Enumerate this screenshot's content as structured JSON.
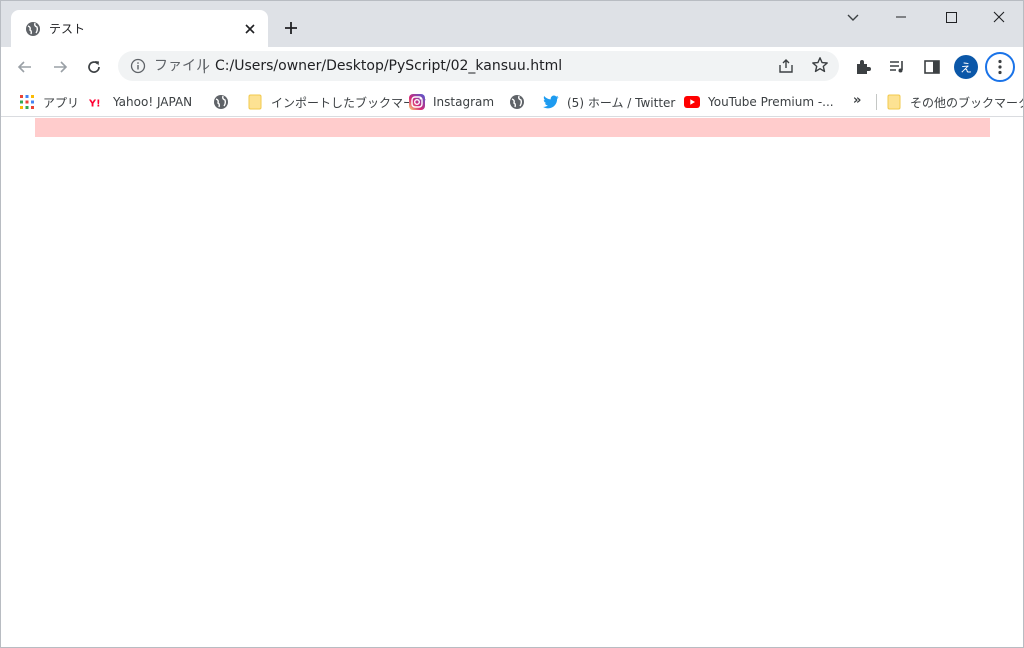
{
  "tab": {
    "title": "テスト"
  },
  "omnibox": {
    "scheme_label": "ファイル",
    "separator": "|",
    "url": "C:/Users/owner/Desktop/PyScript/02_kansuu.html"
  },
  "profile": {
    "initial": "え"
  },
  "bookmarks": [
    {
      "label": "アプリ",
      "icon": "apps-grid-icon"
    },
    {
      "label": "Yahoo! JAPAN",
      "icon": "yahoo-icon"
    },
    {
      "label": "",
      "icon": "globe-icon"
    },
    {
      "label": "インポートしたブックマーク",
      "icon": "folder-icon"
    },
    {
      "label": "Instagram",
      "icon": "instagram-icon"
    },
    {
      "label": "",
      "icon": "globe-icon"
    },
    {
      "label": "(5) ホーム / Twitter",
      "icon": "twitter-icon"
    },
    {
      "label": "YouTube Premium -...",
      "icon": "youtube-icon"
    },
    {
      "label": "その他のブックマーク",
      "icon": "folder-icon"
    }
  ],
  "bookmarks_overflow": "»",
  "colors": {
    "tabstrip": "#dee1e6",
    "page_bar": "#ffcccc",
    "avatar": "#0b57a8",
    "focus_ring": "#1a73e8"
  }
}
